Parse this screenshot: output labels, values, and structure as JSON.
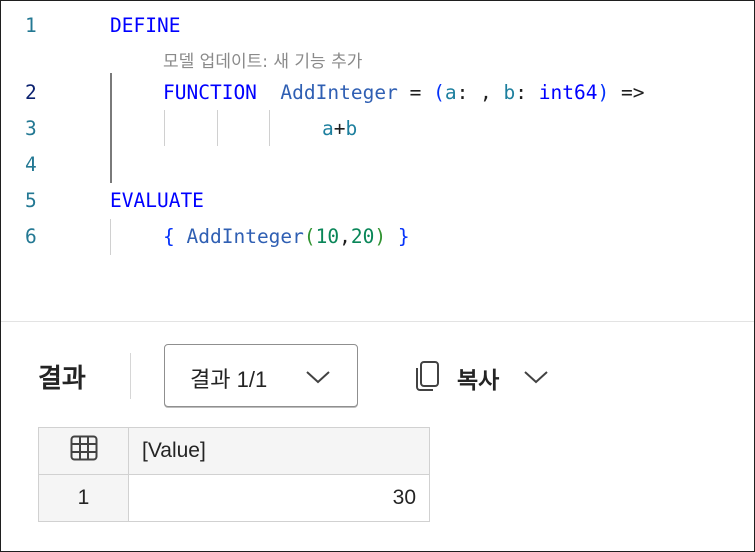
{
  "editor": {
    "line_numbers": [
      "1",
      "2",
      "3",
      "4",
      "5",
      "6"
    ],
    "active_line": "2",
    "code": {
      "define_kw": "DEFINE",
      "inlay_hint": "모델 업데이트: 새 기능 추가",
      "function_kw": "FUNCTION",
      "function_name": "AddInteger",
      "eq": "=",
      "paren_open": "(",
      "param_a": "a",
      "colon_comma": ": , ",
      "param_b": "b",
      "colon_space": ": ",
      "type_kw": "int64",
      "paren_close": ")",
      "arrow": " =>",
      "body_a": "a",
      "body_plus": "+",
      "body_b": "b",
      "evaluate_kw": "EVALUATE",
      "brace_open": "{",
      "call_name": "AddInteger",
      "call_paren_open": "(",
      "arg1": "10",
      "comma": ",",
      "arg2": "20",
      "call_paren_close": ")",
      "brace_close": "}"
    }
  },
  "results": {
    "title": "결과",
    "dropdown_label": "결과 1/1",
    "copy_label": "복사",
    "table": {
      "columns": [
        "[Value]"
      ],
      "rows": [
        {
          "row_number": "1",
          "values": [
            "30"
          ]
        }
      ]
    }
  },
  "icons": {
    "dropdown": "chevron-down-icon",
    "copy": "copy-icon",
    "table_corner": "table-grid-icon"
  },
  "colors": {
    "keyword": "#0000ff",
    "function_name": "#2f5fb3",
    "identifier": "#1d7f9e",
    "number": "#098658",
    "line_number": "#237893",
    "active_line_number": "#0b216f"
  }
}
